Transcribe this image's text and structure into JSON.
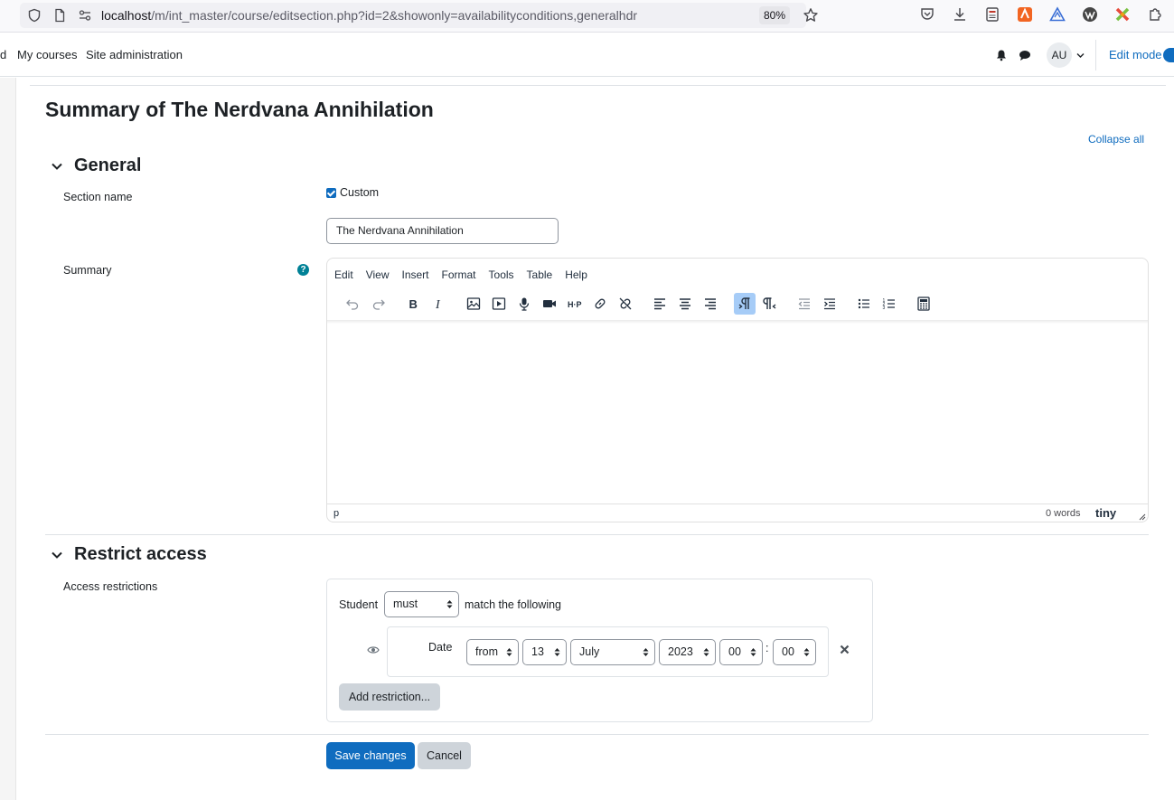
{
  "browser": {
    "url_host": "localhost",
    "url_path": "/m/int_master/course/editsection.php?id=2&showonly=availabilityconditions,generalhdr",
    "zoom": "80%"
  },
  "navbar": {
    "partial_item": "d",
    "my_courses": "My courses",
    "site_admin": "Site administration",
    "avatar_initials": "AU",
    "edit_mode": "Edit mode"
  },
  "page": {
    "title": "Summary of The Nerdvana Annihilation",
    "collapse_all": "Collapse all"
  },
  "general": {
    "heading": "General",
    "section_name_label": "Section name",
    "custom_label": "Custom",
    "custom_checked": true,
    "section_name_value": "The Nerdvana Annihilation",
    "summary_label": "Summary"
  },
  "editor": {
    "menu": [
      "Edit",
      "View",
      "Insert",
      "Format",
      "Tools",
      "Table",
      "Help"
    ],
    "status_path": "p",
    "word_count": "0 words",
    "brand": "tiny"
  },
  "restrict": {
    "heading": "Restrict access",
    "label": "Access restrictions",
    "student_label": "Student",
    "must_value": "must",
    "match_text": "match the following",
    "date_label": "Date",
    "direction": "from",
    "day": "13",
    "month": "July",
    "year": "2023",
    "hour": "00",
    "time_sep": ":",
    "minute": "00",
    "add_restriction": "Add restriction..."
  },
  "actions": {
    "save": "Save changes",
    "cancel": "Cancel"
  },
  "colors": {
    "primary": "#0f6cbf",
    "help": "#008196",
    "active_toolbar": "#a6ccf7"
  }
}
